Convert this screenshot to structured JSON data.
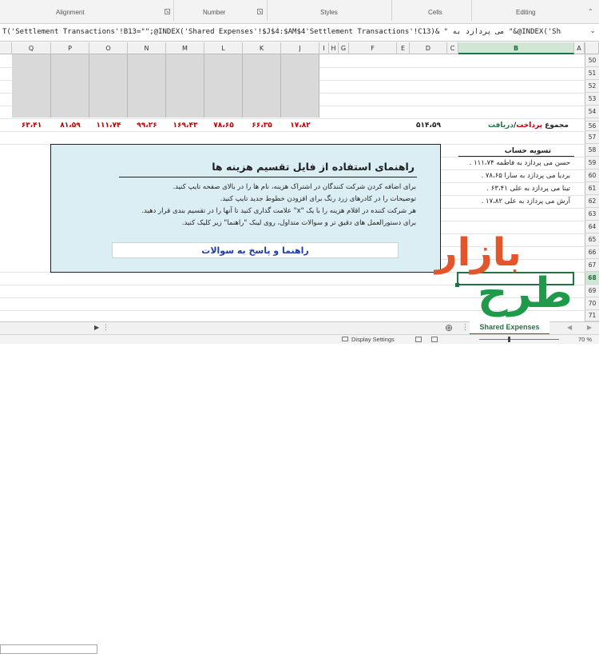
{
  "ribbon": {
    "groups": [
      "Alignment",
      "Number",
      "Styles",
      "Cells",
      "Editing"
    ],
    "launcher_glyph": "↘"
  },
  "formula_bar": {
    "formula": "T('Settlement Transactions'!B13=\"\";@INDEX('Shared Expenses'!$J$4:$AM$4'Settlement Transactions'!C13)& \" می پردازد به \"&@INDEX('Shared",
    "dropdown_glyph": "⌄"
  },
  "columns": [
    "Q",
    "P",
    "O",
    "N",
    "M",
    "L",
    "K",
    "J",
    "I",
    "H",
    "G",
    "F",
    "E",
    "D",
    "C",
    "B",
    "A"
  ],
  "rows": [
    "50",
    "51",
    "52",
    "53",
    "54",
    "55",
    "56",
    "57",
    "58",
    "59",
    "60",
    "61",
    "62",
    "63",
    "64",
    "65",
    "66",
    "67",
    "68",
    "69",
    "70",
    "71"
  ],
  "totals_row": {
    "values": [
      "۶۳،۴۱",
      "۸۱،۵۹",
      "۱۱۱،۷۴",
      "۹۹،۲۶",
      "۱۶۹،۴۳",
      "۷۸،۶۵",
      "۶۶،۳۵",
      "۱۷،۸۲"
    ],
    "d_value": "۵۱۴،۵۹",
    "label_prefix": "مجموع ",
    "label_paid": "پرداخت",
    "label_sep": "/",
    "label_received": "دریافت"
  },
  "settlement": {
    "title": "تسویه حساب",
    "lines": [
      "حسن می پردازد به فاطمه ۱۱۱،۷۴ .",
      "بردیا می پردازد به سارا ۷۸،۶۵ .",
      "تینا می پردازد به علی ۶۳،۴۱ .",
      "آرش می پردازد به علی ۱۷،۸۲ ."
    ]
  },
  "help_box": {
    "title": "راهنمای استفاده از فایل تقسیم هزینه ها",
    "lines": [
      "برای اضافه کردن شرکت کنندگان در اشتراک هزینه، نام ها را در بالای صفحه تایپ کنید.",
      "توضیحات را در کادرهای زرد رنگ برای افزودن خطوط جدید تایپ کنید.",
      "هر شرکت کننده در اقلام هزینه را با یک \"x\" علامت گذاری کنید تا آنها را در تقسیم بندی قرار دهید.",
      "برای دستورالعمل های دقیق تر و سوالات متداول، روی لینک \"راهنما\" زیر کلیک کنید."
    ],
    "link_label": "راهنما و پاسخ به سوالات"
  },
  "logo": {
    "line1": "بازار",
    "line2": "طرح"
  },
  "sheet_tabs": {
    "active_tab": "Shared Expenses",
    "add_glyph": "⊕",
    "prev_glyph": "◀",
    "next_glyph": "▶",
    "more_glyph": "⋮"
  },
  "status_bar": {
    "display_settings": "Display Settings",
    "zoom": "70 %"
  },
  "colors": {
    "accent_green": "#217346",
    "total_red": "#c00000",
    "help_bg": "#dbeef4",
    "link_blue": "#1f3ea8",
    "logo_red": "#e4552b",
    "logo_green": "#1e9a4a"
  }
}
